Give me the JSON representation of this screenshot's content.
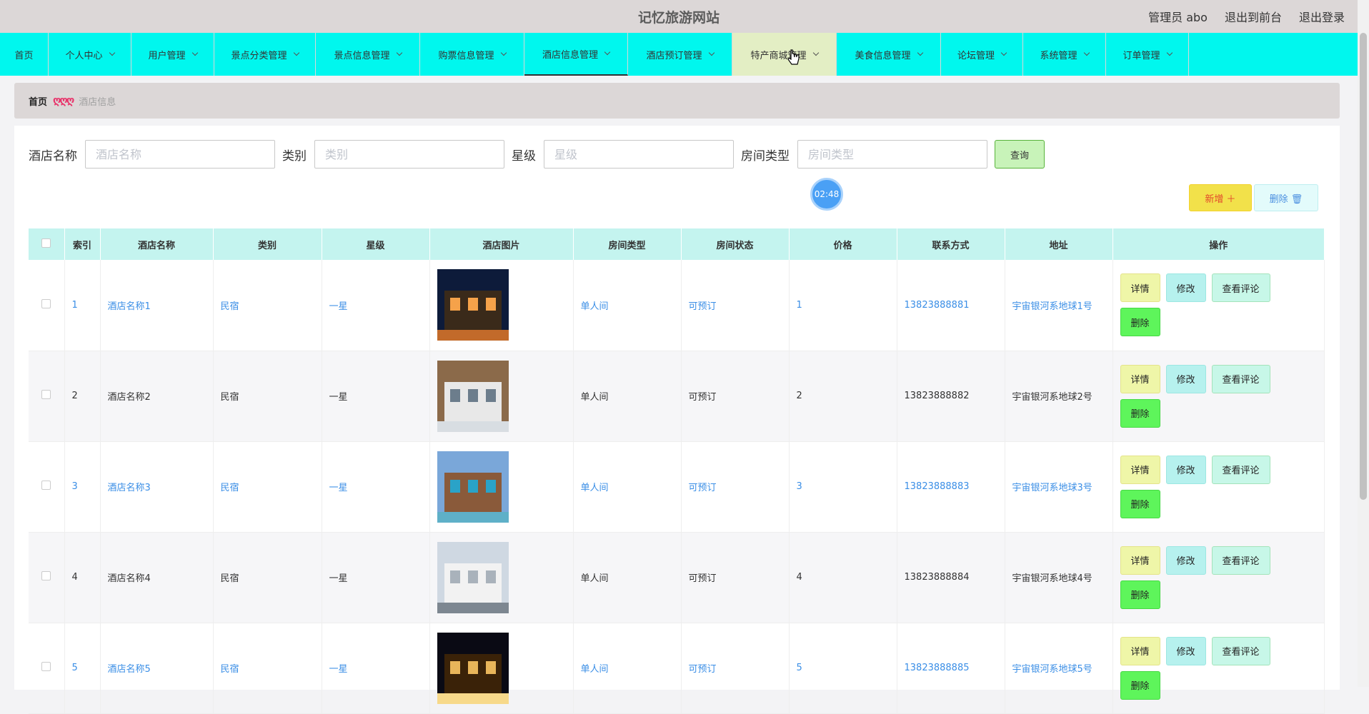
{
  "header": {
    "site_title": "记忆旅游网站",
    "admin_label": "管理员 abo",
    "back_to_front": "退出到前台",
    "logout": "退出登录"
  },
  "nav": {
    "items": [
      {
        "label": "首页",
        "has_dropdown": false
      },
      {
        "label": "个人中心",
        "has_dropdown": true
      },
      {
        "label": "用户管理",
        "has_dropdown": true
      },
      {
        "label": "景点分类管理",
        "has_dropdown": true
      },
      {
        "label": "景点信息管理",
        "has_dropdown": true
      },
      {
        "label": "购票信息管理",
        "has_dropdown": true
      },
      {
        "label": "酒店信息管理",
        "has_dropdown": true,
        "active": true
      },
      {
        "label": "酒店预订管理",
        "has_dropdown": true
      },
      {
        "label": "特产商城管理",
        "has_dropdown": true,
        "hovered": true
      },
      {
        "label": "美食信息管理",
        "has_dropdown": true
      },
      {
        "label": "论坛管理",
        "has_dropdown": true
      },
      {
        "label": "系统管理",
        "has_dropdown": true
      },
      {
        "label": "订单管理",
        "has_dropdown": true
      }
    ]
  },
  "breadcrumb": {
    "home": "首页",
    "current": "酒店信息"
  },
  "search": {
    "fields": [
      {
        "label": "酒店名称",
        "placeholder": "酒店名称",
        "value": ""
      },
      {
        "label": "类别",
        "placeholder": "类别",
        "value": ""
      },
      {
        "label": "星级",
        "placeholder": "星级",
        "value": ""
      },
      {
        "label": "房间类型",
        "placeholder": "房间类型",
        "value": ""
      }
    ],
    "query_label": "查询"
  },
  "timer": "02:48",
  "actions": {
    "add_label": "新增 ＋",
    "delete_label": "删除 🗑"
  },
  "table": {
    "columns": [
      "索引",
      "酒店名称",
      "类别",
      "星级",
      "酒店图片",
      "房间类型",
      "房间状态",
      "价格",
      "联系方式",
      "地址",
      "操作"
    ],
    "rows": [
      {
        "index": "1",
        "name": "酒店名称1",
        "category": "民宿",
        "star": "一星",
        "room_type": "单人间",
        "status": "可预订",
        "price": "1",
        "phone": "13823888881",
        "address": "宇宙银河系地球1号"
      },
      {
        "index": "2",
        "name": "酒店名称2",
        "category": "民宿",
        "star": "一星",
        "room_type": "单人间",
        "status": "可预订",
        "price": "2",
        "phone": "13823888882",
        "address": "宇宙银河系地球2号"
      },
      {
        "index": "3",
        "name": "酒店名称3",
        "category": "民宿",
        "star": "一星",
        "room_type": "单人间",
        "status": "可预订",
        "price": "3",
        "phone": "13823888883",
        "address": "宇宙银河系地球3号"
      },
      {
        "index": "4",
        "name": "酒店名称4",
        "category": "民宿",
        "star": "一星",
        "room_type": "单人间",
        "status": "可预订",
        "price": "4",
        "phone": "13823888884",
        "address": "宇宙银河系地球4号"
      },
      {
        "index": "5",
        "name": "酒店名称5",
        "category": "民宿",
        "star": "一星",
        "room_type": "单人间",
        "status": "可预订",
        "price": "5",
        "phone": "13823888885",
        "address": "宇宙银河系地球5号"
      }
    ],
    "row_buttons": {
      "detail": "详情",
      "edit": "修改",
      "view_comments": "查看评论",
      "delete": "删除"
    }
  },
  "colors": {
    "nav_bg": "#00f7ee",
    "header_bg": "#dcd7d7",
    "table_head_bg": "#c4f4ef",
    "link_blue": "#3a8ee6"
  }
}
